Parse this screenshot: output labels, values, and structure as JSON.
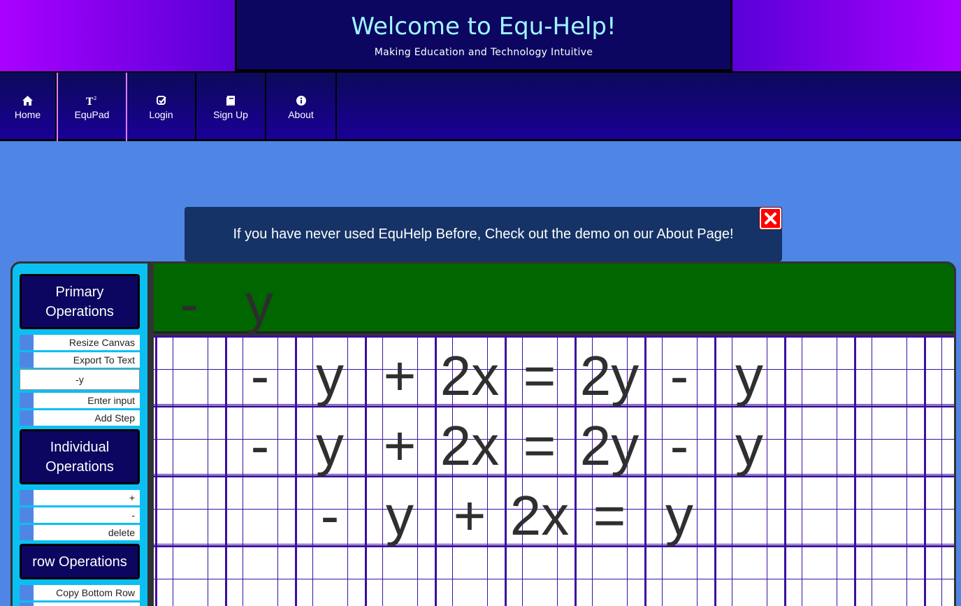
{
  "header": {
    "title": "Welcome to Equ-Help!",
    "subtitle": "Making Education and Technology Intuitive"
  },
  "nav": {
    "items": [
      {
        "label": "Home",
        "icon": "home-icon"
      },
      {
        "label": "EquPad",
        "icon": "superscript-icon",
        "active": true
      },
      {
        "label": "Login",
        "icon": "check-square-icon"
      },
      {
        "label": "Sign Up",
        "icon": "book-icon"
      },
      {
        "label": "About",
        "icon": "info-circle-icon"
      }
    ]
  },
  "alert": {
    "message": "If you have never used EquHelp Before, Check out the demo on our About Page!",
    "close_icon": "close-icon"
  },
  "sidebar": {
    "primary_title": "Primary Operations",
    "resize_canvas": "Resize Canvas",
    "export_to_text": "Export To Text",
    "input_value": "-y",
    "enter_input": "Enter input",
    "add_step": "Add Step",
    "individual_title": "Individual Operations",
    "plus": "+",
    "minus": "-",
    "delete": "delete",
    "row_title": "row Operations",
    "copy_bottom_row": "Copy Bottom Row"
  },
  "input_display": [
    "-",
    "y"
  ],
  "rows": [
    [
      "-",
      "y",
      "+",
      "2x",
      "=",
      "2y",
      "-",
      "y"
    ],
    [
      "-",
      "y",
      "+",
      "2x",
      "=",
      "2y",
      "-",
      "y"
    ],
    [
      "-",
      "y",
      "+",
      "2x",
      "=",
      "y"
    ]
  ],
  "colors": {
    "background": "#4f86e6",
    "header_box": "#0d0660",
    "title_text": "#9ef6ff",
    "sidebar": "#0bbff2",
    "input_display": "#006600",
    "grid_lines": "#3b0fa0",
    "alert": "#153366",
    "close_button": "#ff0000"
  }
}
